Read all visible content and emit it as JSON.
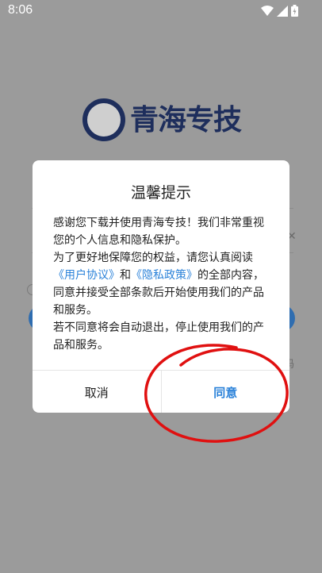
{
  "status_bar": {
    "time": "8:06"
  },
  "app": {
    "logo_text": "青海专技"
  },
  "dialog": {
    "title": "温馨提示",
    "body": {
      "para1": "感谢您下载并使用青海专技！我们非常重视您的个人信息和隐私保护。",
      "para2_prefix": "为了更好地保障您的权益，请您认真阅读",
      "user_agreement_link": "《用户协议》",
      "and": "和",
      "privacy_policy_link": "《隐私政策》",
      "para2_suffix": "的全部内容，同意并接受全部条款后开始使用我们的产品和服务。",
      "para3": "若不同意将会自动退出，停止使用我们的产品和服务。"
    },
    "cancel_label": "取消",
    "agree_label": "同意"
  },
  "colors": {
    "link": "#2b82d9",
    "annotation": "#e01010",
    "brand": "#1e2e5c"
  }
}
